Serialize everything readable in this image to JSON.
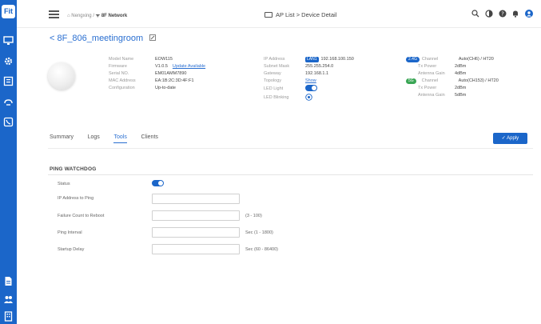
{
  "app": {
    "logo_text": "Fit"
  },
  "breadcrumb": {
    "org": "Nengxing",
    "site": "8F Network"
  },
  "header": {
    "title": "AP List > Device Detail"
  },
  "device": {
    "name": "< 8F_806_meetingroom"
  },
  "info_left": [
    {
      "label": "Model Name",
      "value": "EOW115"
    },
    {
      "label": "Firmware",
      "value": "V1.0.5",
      "link": "Update Available"
    },
    {
      "label": "Serial NO.",
      "value": "EM01AMM7890"
    },
    {
      "label": "MAC Address",
      "value": "EA:1B:2C:3D:4F:F1"
    },
    {
      "label": "Configuration",
      "value": "Up-to-date"
    }
  ],
  "info_mid": [
    {
      "label": "IP Address",
      "badge": "LAN1",
      "value": "192.168.100.150"
    },
    {
      "label": "Subnet Mask",
      "value": "255.255.254.0"
    },
    {
      "label": "Gateway",
      "value": "192.168.1.1"
    },
    {
      "label": "Topology",
      "value": "Show"
    },
    {
      "label": "LED Light"
    },
    {
      "label": "LED Blinking"
    }
  ],
  "radio_24": {
    "badge": "2.4G",
    "rows": [
      {
        "label": "Channel",
        "value": "Auto(CH6) / HT20"
      },
      {
        "label": "Tx Power",
        "value": "2dBm"
      },
      {
        "label": "Antenna Gain",
        "value": "4dBm"
      }
    ]
  },
  "radio_5": {
    "badge": "5G",
    "rows": [
      {
        "label": "Channel",
        "value": "Auto(CH153) / HT20"
      },
      {
        "label": "Tx Power",
        "value": "2dBm"
      },
      {
        "label": "Antenna Gain",
        "value": "5dBm"
      }
    ]
  },
  "tabs": [
    "Summary",
    "Logs",
    "Tools",
    "Clients"
  ],
  "active_tab": "Tools",
  "apply_label": "Apply",
  "ping_watchdog": {
    "title": "PING WATCHDOG",
    "status_label": "Status",
    "status_on": true,
    "fields": [
      {
        "label": "IP Address to Ping",
        "value": "",
        "hint": ""
      },
      {
        "label": "Failure Count to Reboot",
        "value": "",
        "hint": "(3 - 100)"
      },
      {
        "label": "Ping Interval",
        "value": "",
        "hint": "Sec (1 - 1800)"
      },
      {
        "label": "Startup Delay",
        "value": "",
        "hint": "Sec (60 - 86400)"
      }
    ]
  },
  "colors": {
    "primary": "#1b66c9",
    "badge_24": "#1b66c9",
    "badge_5": "#3aa655"
  }
}
